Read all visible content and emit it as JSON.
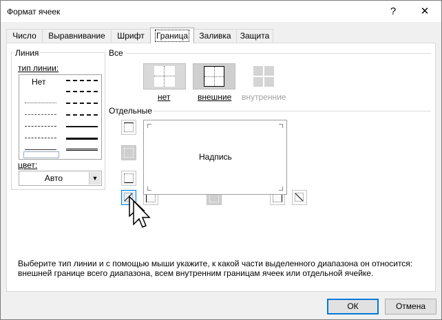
{
  "window": {
    "title": "Формат ячеек",
    "help_button": "?",
    "close_button": "✕"
  },
  "tabs": [
    "Число",
    "Выравнивание",
    "Шрифт",
    "Граница",
    "Заливка",
    "Защита"
  ],
  "active_tab": "Граница",
  "line_group": {
    "title": "Линия",
    "style_label": "тип линии:",
    "none_label": "Нет",
    "color_label": "цвет:",
    "color_value": "Авто"
  },
  "presets_group": {
    "title": "Все",
    "items": [
      "нет",
      "внешние",
      "внутренние"
    ]
  },
  "border_group": {
    "title": "Отдельные",
    "preview_text": "Надпись"
  },
  "help_text": "Выберите тип линии и с помощью мыши укажите, к какой части выделенного диапазона он относится: внешней границе всего диапазона, всем внутренним границам ячеек или отдельной ячейке.",
  "buttons": {
    "ok": "ОК",
    "cancel": "Отмена"
  },
  "colors": {
    "accent": "#0078d7",
    "button_face": "#e1e1e1",
    "dialog_bg": "#f0f0f0"
  }
}
